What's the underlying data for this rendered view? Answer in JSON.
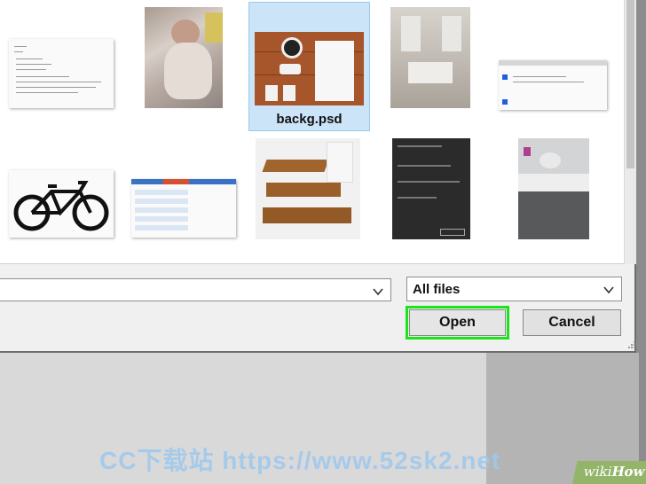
{
  "files": [
    {
      "name": "doc-a",
      "label": ""
    },
    {
      "name": "baby-photo",
      "label": ""
    },
    {
      "name": "backg",
      "label": "backg.psd",
      "selected": true
    },
    {
      "name": "kitchen",
      "label": ""
    },
    {
      "name": "screenshot",
      "label": ""
    },
    {
      "name": "bicycle",
      "label": ""
    },
    {
      "name": "spreadsheet",
      "label": ""
    },
    {
      "name": "stairs",
      "label": ""
    },
    {
      "name": "dark-dialog",
      "label": ""
    },
    {
      "name": "cabinet",
      "label": ""
    }
  ],
  "filter": {
    "selected": "All files"
  },
  "path": {
    "value": ""
  },
  "buttons": {
    "open": "Open",
    "cancel": "Cancel"
  },
  "watermark": "CC下载站  https://www.52sk2.net",
  "badge": {
    "wiki": "wiki",
    "how": "How"
  },
  "icons": [
    "chevron-down-icon",
    "resize-grip-icon"
  ],
  "colors": {
    "selection": "#cce4f7",
    "highlight": "#19e619",
    "badge": "#93b56a",
    "watermark": "#9ec8ee"
  }
}
